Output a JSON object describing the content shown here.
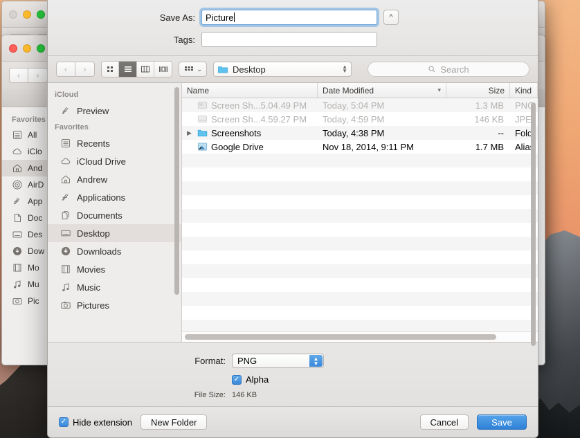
{
  "desktop": {
    "wallpaper_name": "yosemite-wallpaper"
  },
  "background_windows": {
    "back": {
      "traffic_lights": [
        "grey",
        "yellow",
        "green"
      ],
      "sidebar_toggle": "sidebar-toggle"
    },
    "front": {
      "traffic_lights": [
        "red",
        "yellow",
        "green"
      ],
      "back_label": "‹",
      "forward_label": "›",
      "add_tab_label": "+",
      "sidebar": {
        "section_title": "Favorites",
        "items": [
          {
            "label": "All",
            "icon": "recents-icon"
          },
          {
            "label": "iClo",
            "icon": "icloud-icon"
          },
          {
            "label": "And",
            "icon": "home-icon",
            "selected": true
          },
          {
            "label": "AirD",
            "icon": "airdrop-icon"
          },
          {
            "label": "App",
            "icon": "applications-icon"
          },
          {
            "label": "Doc",
            "icon": "documents-icon"
          },
          {
            "label": "Des",
            "icon": "desktop-icon"
          },
          {
            "label": "Dow",
            "icon": "downloads-icon"
          },
          {
            "label": "Mo",
            "icon": "movies-icon"
          },
          {
            "label": "Mu",
            "icon": "music-icon"
          },
          {
            "label": "Pic",
            "icon": "pictures-icon"
          }
        ]
      }
    }
  },
  "dialog": {
    "save_as": {
      "label": "Save As:",
      "value": "Picture",
      "placeholder": "",
      "collapse_icon": "chevron-up-icon"
    },
    "tags": {
      "label": "Tags:",
      "value": "",
      "placeholder": ""
    },
    "toolbar": {
      "back_label": "‹",
      "forward_label": "›",
      "view_modes": [
        {
          "name": "icon-view",
          "icon": "grid-icon",
          "active": false
        },
        {
          "name": "list-view",
          "icon": "list-icon",
          "active": true
        },
        {
          "name": "column-view",
          "icon": "columns-icon",
          "active": false
        },
        {
          "name": "coverflow-view",
          "icon": "coverflow-icon",
          "active": false
        }
      ],
      "arrange_icon": "arrange-icon",
      "arrange_chevron": "⌄",
      "path_popup": {
        "label": "Desktop",
        "icon": "folder-icon"
      },
      "search": {
        "placeholder": "Search",
        "icon": "search-icon",
        "value": ""
      }
    },
    "sidebar": {
      "sections": [
        {
          "title": "iCloud",
          "items": [
            {
              "label": "Preview",
              "icon": "applications-icon",
              "selected": false
            }
          ]
        },
        {
          "title": "Favorites",
          "items": [
            {
              "label": "Recents",
              "icon": "recents-icon",
              "selected": false
            },
            {
              "label": "iCloud Drive",
              "icon": "icloud-icon",
              "selected": false
            },
            {
              "label": "Andrew",
              "icon": "home-icon",
              "selected": false
            },
            {
              "label": "Applications",
              "icon": "applications-icon",
              "selected": false
            },
            {
              "label": "Documents",
              "icon": "documents-icon",
              "selected": false
            },
            {
              "label": "Desktop",
              "icon": "desktop-icon",
              "selected": true
            },
            {
              "label": "Downloads",
              "icon": "downloads-icon",
              "selected": false
            },
            {
              "label": "Movies",
              "icon": "movies-icon",
              "selected": false
            },
            {
              "label": "Music",
              "icon": "music-icon",
              "selected": false
            },
            {
              "label": "Pictures",
              "icon": "pictures-icon",
              "selected": false
            }
          ]
        }
      ]
    },
    "file_list": {
      "columns": [
        {
          "key": "name",
          "label": "Name"
        },
        {
          "key": "date",
          "label": "Date Modified",
          "sort_icon": "chevron-down-icon"
        },
        {
          "key": "size",
          "label": "Size"
        },
        {
          "key": "kind",
          "label": "Kind"
        }
      ],
      "rows": [
        {
          "name": "Screen Sh...5.04.49 PM",
          "date": "Today, 5:04 PM",
          "size": "1.3 MB",
          "kind": "PNG",
          "icon": "image-file-icon",
          "dimmed": true,
          "disclosure": false
        },
        {
          "name": "Screen Sh...4.59.27 PM",
          "date": "Today, 4:59 PM",
          "size": "146 KB",
          "kind": "JPE",
          "icon": "image-file-icon",
          "dimmed": true,
          "disclosure": false
        },
        {
          "name": "Screenshots",
          "date": "Today, 4:38 PM",
          "size": "--",
          "kind": "Fold",
          "icon": "folder-icon",
          "dimmed": false,
          "disclosure": true
        },
        {
          "name": "Google Drive",
          "date": "Nov 18, 2014, 9:11 PM",
          "size": "1.7 MB",
          "kind": "Alias",
          "icon": "alias-icon",
          "dimmed": false,
          "disclosure": false
        }
      ]
    },
    "format_panel": {
      "format_label": "Format:",
      "format_value": "PNG",
      "alpha_label": "Alpha",
      "alpha_checked": true,
      "file_size_label": "File Size:",
      "file_size_value": "146 KB"
    },
    "bottom_bar": {
      "hide_extension_label": "Hide extension",
      "hide_extension_checked": true,
      "new_folder_label": "New Folder",
      "cancel_label": "Cancel",
      "save_label": "Save",
      "checkmark": "✓"
    }
  },
  "colors": {
    "accent_blue": "#3c88d8",
    "save_button": "#2e81d6",
    "selected_row": "#e3dddb",
    "folder_blue": "#5ec3ef"
  }
}
